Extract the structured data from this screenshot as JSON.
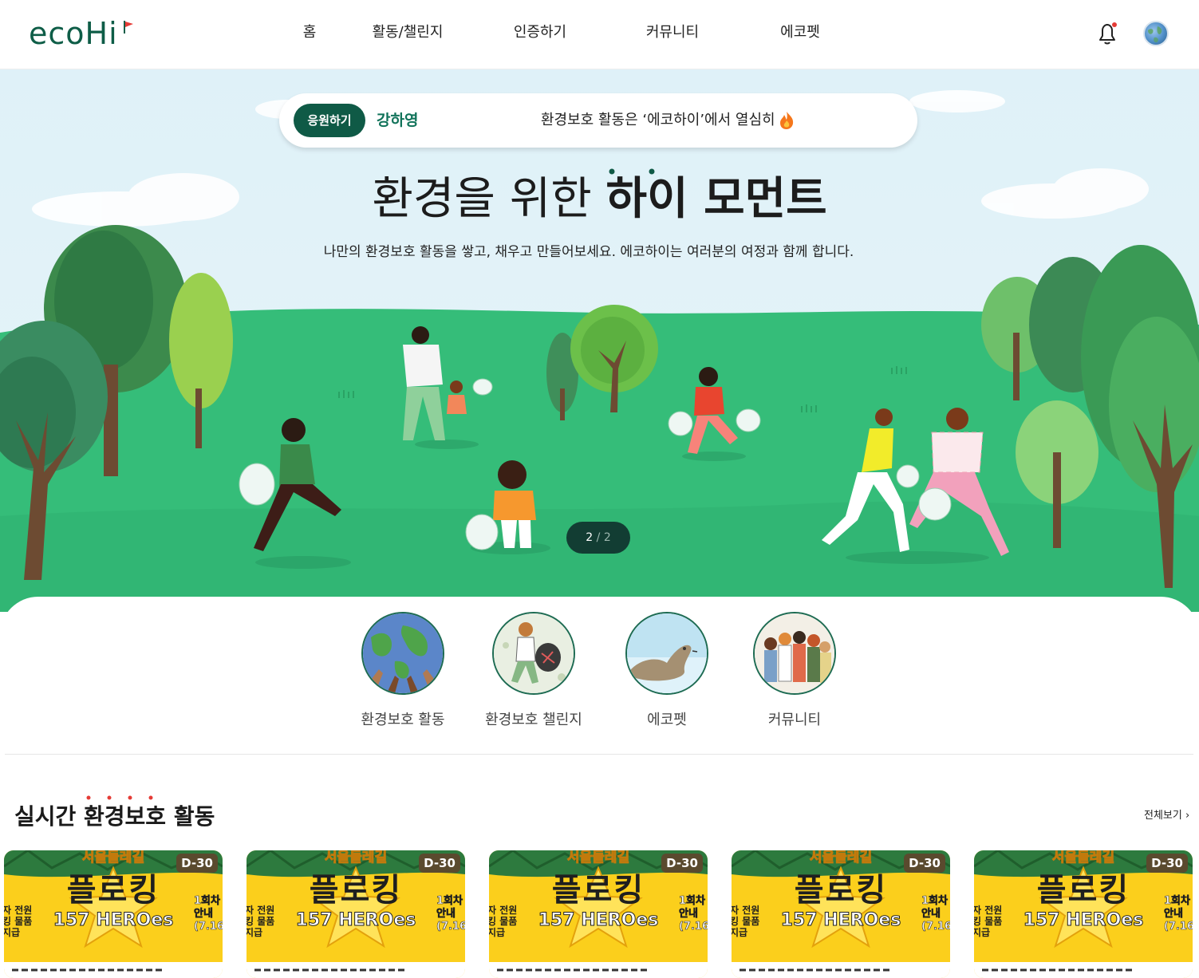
{
  "header": {
    "logo_text": "ecoHi",
    "nav": [
      "홈",
      "활동/챌린지",
      "인증하기",
      "커뮤니티",
      "에코펫"
    ]
  },
  "hero": {
    "ticker": {
      "button_label": "응원하기",
      "name": "강하영",
      "message": "환경보호 활동은 ‘에코하이’에서 열심히"
    },
    "title_regular": "환경을 위한 ",
    "title_bold": "하이 모먼트",
    "subtitle": "나만의 환경보호 활동을 쌓고, 채우고 만들어보세요. 에코하이는 여러분의 여정과 함께 합니다.",
    "pager_current": "2",
    "pager_sep": " / ",
    "pager_total": "2"
  },
  "categories": [
    {
      "label": "환경보호 활동",
      "icon": "earth-hands-icon"
    },
    {
      "label": "환경보호 챌린지",
      "icon": "plogging-illustration-icon"
    },
    {
      "label": "에코펫",
      "icon": "seal-icon"
    },
    {
      "label": "커뮤니티",
      "icon": "people-group-icon"
    }
  ],
  "section": {
    "title": "실시간 환경보호 활동",
    "see_all": "전체보기"
  },
  "cards": [
    {
      "badge": "D-30",
      "top": "서울둘레길",
      "main": "플로킹",
      "sub": "157 HEROes",
      "left": "자 전원\n킹 물품\n지급",
      "right": "1회차\n안내\n(7.16"
    },
    {
      "badge": "D-30",
      "top": "서울둘레길",
      "main": "플로킹",
      "sub": "157 HEROes",
      "left": "자 전원\n킹 물품\n지급",
      "right": "1회차\n안내\n(7.16"
    },
    {
      "badge": "D-30",
      "top": "서울둘레길",
      "main": "플로킹",
      "sub": "157 HEROes",
      "left": "자 전원\n킹 물품\n지급",
      "right": "1회차\n안내\n(7.16"
    },
    {
      "badge": "D-30",
      "top": "서울둘레길",
      "main": "플로킹",
      "sub": "157 HEROes",
      "left": "자 전원\n킹 물품\n지급",
      "right": "1회차\n안내\n(7.16"
    },
    {
      "badge": "D-30",
      "top": "서울둘레길",
      "main": "플로킹",
      "sub": "157 HEROes",
      "left": "자 전원\n킹 물품\n지급",
      "right": "1회차\n안내\n(7.16"
    }
  ],
  "colors": {
    "brand_green": "#0f5a46",
    "grass": "#35bd79",
    "sky": "#dff1f8",
    "card_yellow": "#fbcf1c"
  }
}
